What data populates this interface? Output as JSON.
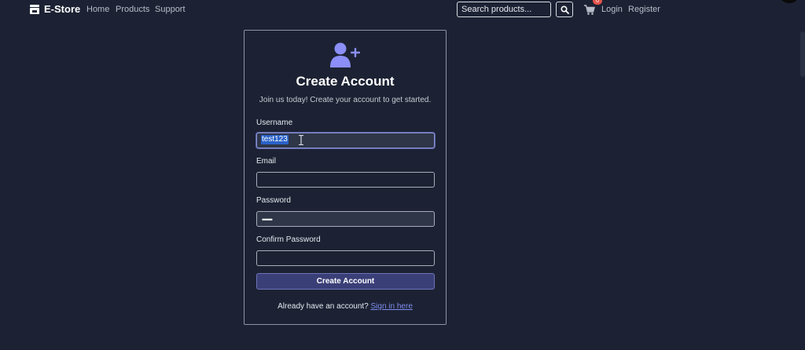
{
  "nav": {
    "brand": "E-Store",
    "links": [
      "Home",
      "Products",
      "Support"
    ],
    "search_placeholder": "Search products...",
    "cart_count": "0",
    "login": "Login",
    "register": "Register"
  },
  "form": {
    "title": "Create Account",
    "subtitle": "Join us today! Create your account to get started.",
    "fields": [
      {
        "label": "Username",
        "value": "test123"
      },
      {
        "label": "Email",
        "value": ""
      },
      {
        "label": "Password",
        "value": "••••••"
      },
      {
        "label": "Confirm Password",
        "value": ""
      }
    ],
    "submit_label": "Create Account",
    "signin_prompt": "Already have an account?",
    "signin_link": "Sign in here"
  },
  "colors": {
    "background": "#1c2233",
    "accent": "#7e8cf0",
    "button": "#3a3f78",
    "badge": "#e5534b"
  }
}
